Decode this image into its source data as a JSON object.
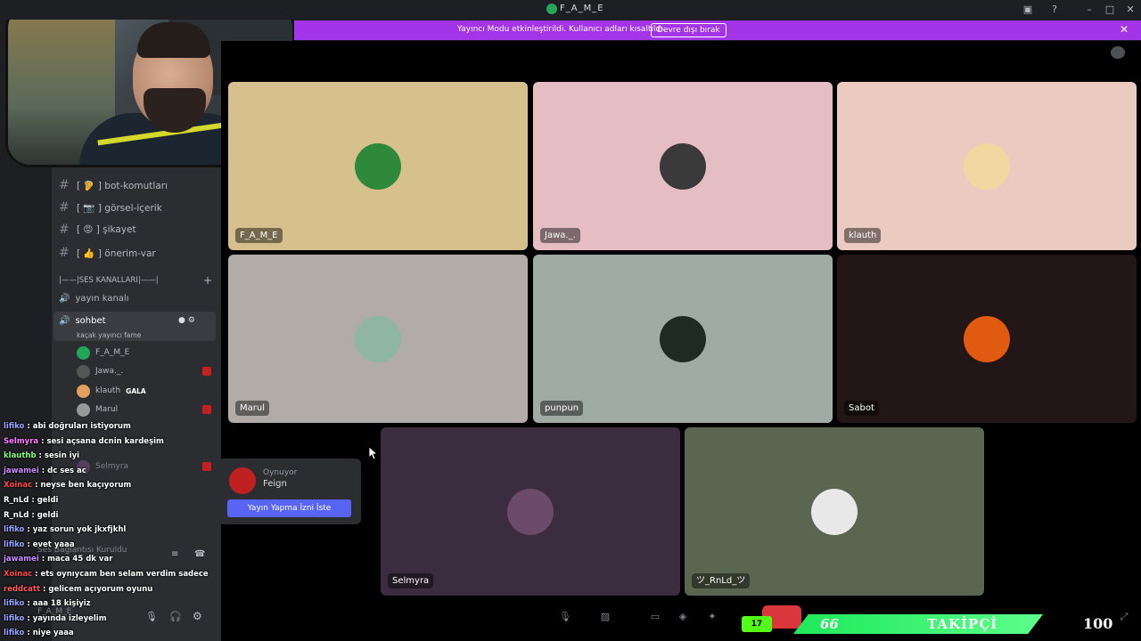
{
  "window": {
    "title": "F_A_M_E"
  },
  "banner": {
    "text": "Yayıncı Modu etkinleştirildi. Kullanıcı adları kısaltıldı.",
    "button": "Devre dışı bırak"
  },
  "sidebar": {
    "channels": [
      {
        "label": "[ 🦻 ] bot-komutları"
      },
      {
        "label": "[ 📷 ] görsel-içerik"
      },
      {
        "label": "[ 😡 ] şikayet"
      },
      {
        "label": "[ 👍 ] önerim-var"
      }
    ],
    "voice_category": "|——|SES KANALLARI|——|",
    "voice_channels": [
      {
        "label": "yayın kanalı"
      },
      {
        "label": "sohbet",
        "status": "kaçak yayıncı fame"
      }
    ],
    "members": [
      {
        "name": "F_A_M_E",
        "color": "#23a55a"
      },
      {
        "name": "Jawa._.",
        "color": "#444"
      },
      {
        "name": "klauth",
        "badge": "GALA",
        "color": "#e0a060"
      },
      {
        "name": "Marul",
        "color": "#999"
      },
      {
        "name": "Selmyra",
        "color": "#6b4f7a"
      }
    ],
    "voice_connected": "Ses Bağlantısı Kuruldu",
    "user_name": "F_A_M_E"
  },
  "chat": [
    {
      "user": "lifiko",
      "color": "#9aa4ff",
      "text": "abi doğruları istiyorum"
    },
    {
      "user": "Selmyra",
      "color": "#ff7aff",
      "text": "sesi açsana dcnin kardeşim"
    },
    {
      "user": "klauthb",
      "color": "#7fff7f",
      "text": "sesin iyi"
    },
    {
      "user": "jawamei",
      "color": "#c88cff",
      "text": "dc ses ac"
    },
    {
      "user": "Xoinac",
      "color": "#ff4a4a",
      "text": "neyse ben kaçıyorum"
    },
    {
      "user": "R_nLd",
      "color": "#ffffff",
      "text": "geldi"
    },
    {
      "user": "R_nLd",
      "color": "#ffffff",
      "text": "geldi"
    },
    {
      "user": "lifiko",
      "color": "#9aa4ff",
      "text": "yaz sorun yok jkxfjkhl"
    },
    {
      "user": "lifiko",
      "color": "#9aa4ff",
      "text": "evet yaaa"
    },
    {
      "user": "jawamei",
      "color": "#c88cff",
      "text": "maca 45 dk var"
    },
    {
      "user": "Xoinac",
      "color": "#ff4a4a",
      "text": "ets oynıycam ben selam verdim sadece"
    },
    {
      "user": "reddcatt",
      "color": "#ff5a5a",
      "text": "gelicem açıyorum oyunu"
    },
    {
      "user": "lifiko",
      "color": "#9aa4ff",
      "text": "aaa 18 kişiyiz"
    },
    {
      "user": "lifiko",
      "color": "#9aa4ff",
      "text": "yayında izleyelim"
    },
    {
      "user": "lifiko",
      "color": "#9aa4ff",
      "text": "niye yaaa"
    }
  ],
  "tiles": [
    {
      "name": "F_A_M_E",
      "bg": "#d6c08d",
      "avatar": "#2e8a3a"
    },
    {
      "name": "Jawa._.",
      "bg": "#e4bec3",
      "avatar": "#3a3a3a"
    },
    {
      "name": "klauth",
      "bg": "#ebcbbf",
      "avatar": "#f0d8a0"
    },
    {
      "name": "Marul",
      "bg": "#b1aca8",
      "avatar": "#8fb6a0"
    },
    {
      "name": "punpun",
      "bg": "#a1aba6",
      "avatar": "#1f2a22"
    },
    {
      "name": "Sabot",
      "bg": "#221617",
      "avatar": "#e05a10"
    },
    {
      "name": "Selmyra",
      "bg": "#3b2d3f",
      "avatar": "#6b4a6a"
    },
    {
      "name": "ツ_RnLd_ツ",
      "bg": "#5a6650",
      "avatar": "#e8e8e8"
    }
  ],
  "game_popup": {
    "status": "Oynuyor",
    "game": "Feign",
    "button": "Yayın Yapma İzni İste"
  },
  "follower": {
    "current": "66",
    "label": "TAKİPÇİ",
    "goal": "100",
    "platform": "17"
  }
}
